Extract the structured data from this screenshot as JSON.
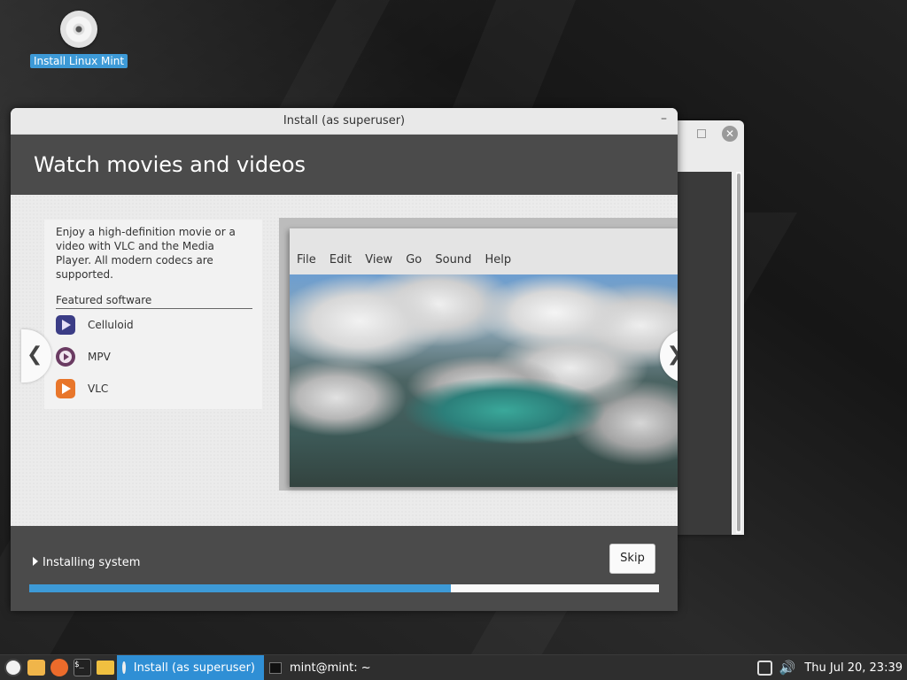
{
  "desktop": {
    "icon_label": "Install Linux Mint"
  },
  "window": {
    "title": "Install (as superuser)",
    "minimize_glyph": "–"
  },
  "slide": {
    "heading": "Watch movies and videos",
    "description": "Enjoy a high-definition movie or a video with VLC and the Media Player. All modern codecs are supported.",
    "featured_label": "Featured software",
    "apps": [
      {
        "name": "Celluloid",
        "icon": "celluloid-icon"
      },
      {
        "name": "MPV",
        "icon": "mpv-icon"
      },
      {
        "name": "VLC",
        "icon": "vlc-icon"
      }
    ],
    "player_menu": [
      "File",
      "Edit",
      "View",
      "Go",
      "Sound",
      "Help"
    ],
    "prev_glyph": "❮",
    "next_glyph": "❯"
  },
  "footer": {
    "status": "Installing system",
    "skip_label": "Skip",
    "progress_percent": 67
  },
  "taskbar": {
    "tasks": [
      {
        "label": "Install (as superuser)",
        "active": true
      },
      {
        "label": "mint@mint: ~",
        "active": false
      }
    ],
    "terminal_glyph": "$_",
    "clock": "Thu Jul 20, 23:39"
  },
  "background_window": {
    "close_glyph": "✕"
  },
  "colors": {
    "accent": "#3d9ad7",
    "banner": "#4b4b4b",
    "taskbar": "#2e2e2e"
  }
}
